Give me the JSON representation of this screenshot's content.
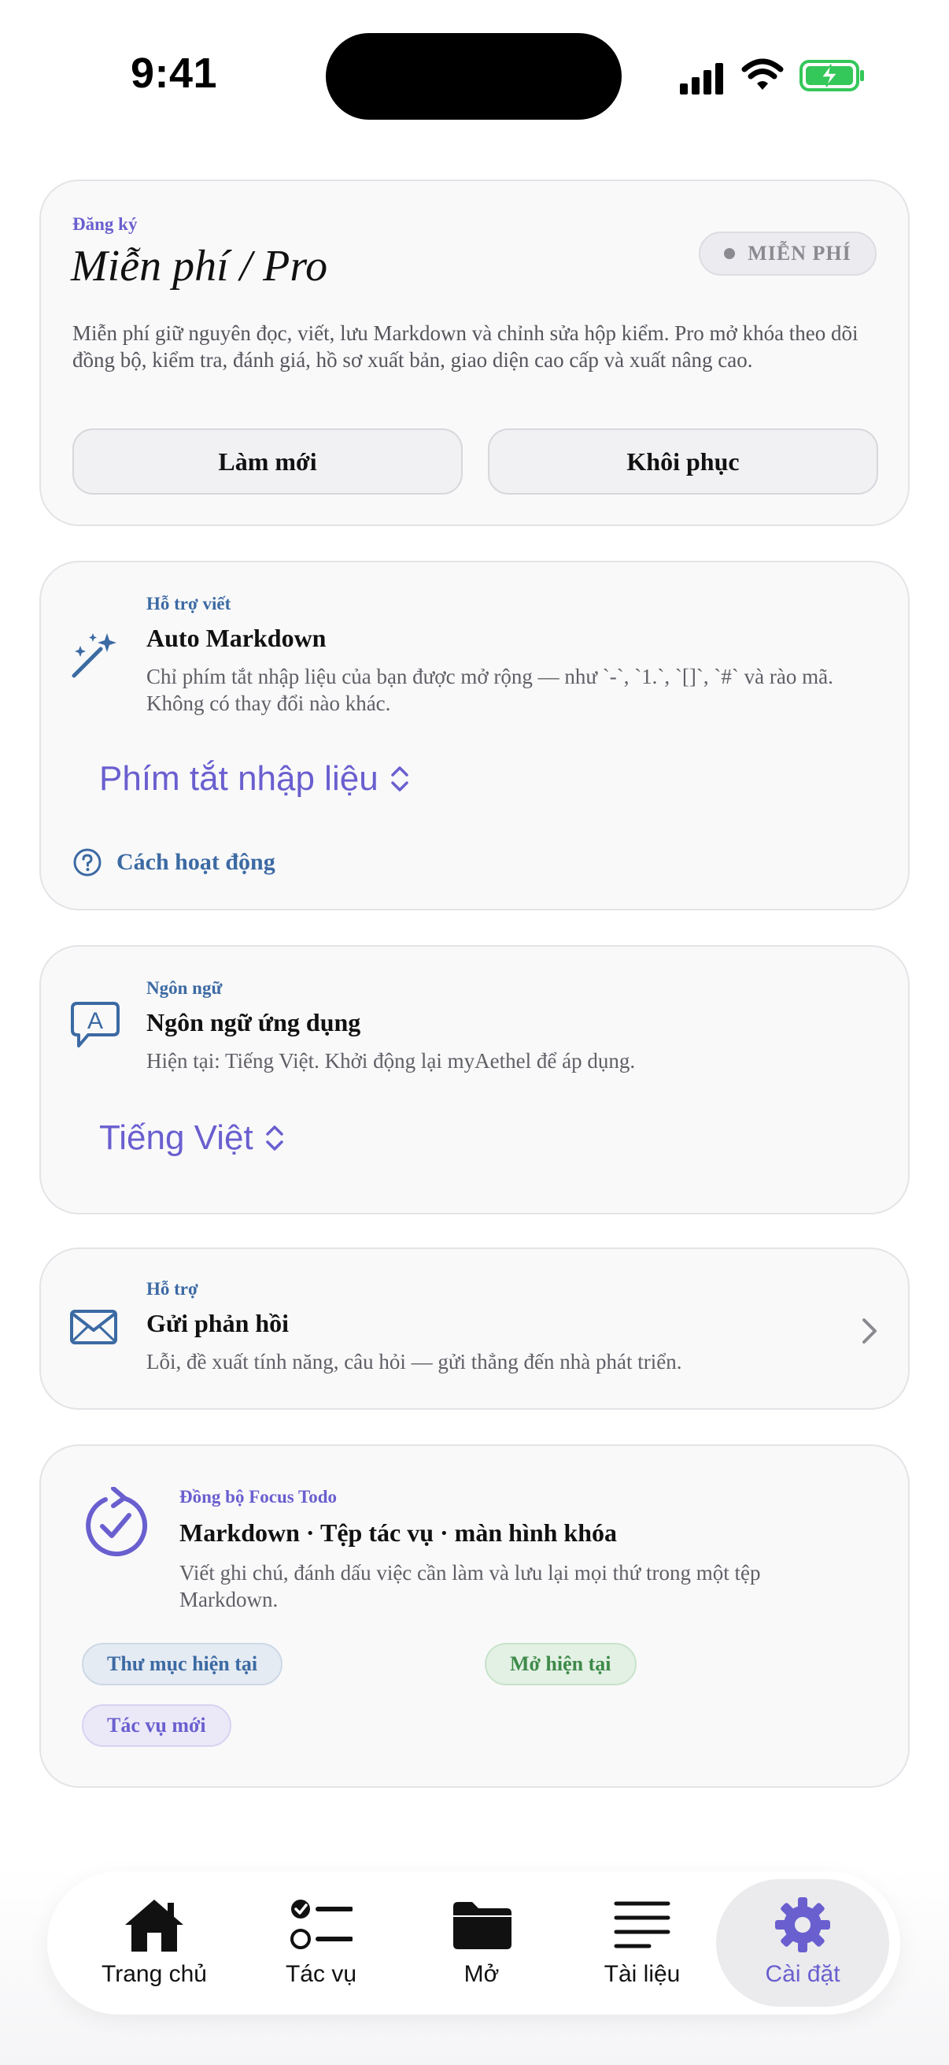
{
  "status_bar": {
    "time": "9:41"
  },
  "subscription": {
    "eyebrow": "Đăng ký",
    "title": "Miễn phí / Pro",
    "badge": "MIỄN PHÍ",
    "description": "Miễn phí giữ nguyên đọc, viết, lưu Markdown và chỉnh sửa hộp kiểm. Pro mở khóa theo dõi đồng bộ, kiểm tra, đánh giá, hồ sơ xuất bản, giao diện cao cấp và xuất nâng cao.",
    "refresh_label": "Làm mới",
    "restore_label": "Khôi phục"
  },
  "writing": {
    "eyebrow": "Hỗ trợ viết",
    "title": "Auto Markdown",
    "description": "Chỉ phím tắt nhập liệu của bạn được mở rộng — như `-`, `1.`, `[]`, `#` và rào mã. Không có thay đổi nào khác.",
    "picker_value": "Phím tắt nhập liệu",
    "howto_label": "Cách hoạt động"
  },
  "language": {
    "eyebrow": "Ngôn ngữ",
    "title": "Ngôn ngữ ứng dụng",
    "description": "Hiện tại: Tiếng Việt. Khởi động lại myAethel để áp dụng.",
    "picker_value": "Tiếng Việt"
  },
  "support": {
    "eyebrow": "Hỗ trợ",
    "title": "Gửi phản hồi",
    "description": "Lỗi, đề xuất tính năng, câu hỏi — gửi thẳng đến nhà phát triển."
  },
  "focus": {
    "eyebrow": "Đồng bộ Focus Todo",
    "title": "Markdown · Tệp tác vụ · màn hình khóa",
    "description": "Viết ghi chú, đánh dấu việc cần làm và lưu lại mọi thứ trong một tệp Markdown.",
    "chip_current_folder": "Thư mục hiện tại",
    "chip_open_current": "Mở hiện tại",
    "chip_new_task": "Tác vụ mới"
  },
  "tabbar": {
    "home": "Trang chủ",
    "tasks": "Tác vụ",
    "open": "Mở",
    "docs": "Tài liệu",
    "settings": "Cài đặt",
    "active": "settings"
  },
  "colors": {
    "accent": "#6a5fcf",
    "link_blue": "#3c6aa3",
    "green": "#3e8a4a",
    "battery_green": "#34c759"
  },
  "icons": {
    "writing": "magic-wand-icon",
    "language": "language-bubble-icon",
    "support": "envelope-icon",
    "focus": "sync-check-icon"
  }
}
